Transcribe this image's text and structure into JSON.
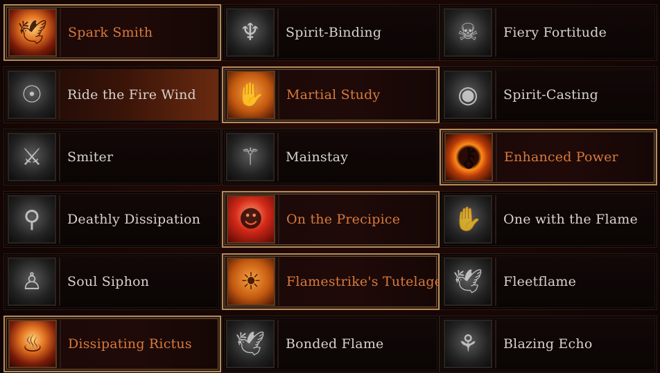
{
  "talents": [
    {
      "name": "Spark Smith",
      "active": true,
      "icon": "phoenix-icon",
      "glyph": "🕊",
      "style": "fire"
    },
    {
      "name": "Spirit-Binding",
      "active": false,
      "icon": "spirit-sigil-icon",
      "glyph": "♆",
      "style": "dark"
    },
    {
      "name": "Fiery Fortitude",
      "active": false,
      "icon": "horned-skull-icon",
      "glyph": "☠",
      "style": "dark"
    },
    {
      "name": "Ride the Fire Wind",
      "active": false,
      "icon": "robed-figure-icon",
      "glyph": "☉",
      "style": "dark"
    },
    {
      "name": "Martial Study",
      "active": true,
      "icon": "open-hand-icon",
      "glyph": "✋",
      "style": "orange"
    },
    {
      "name": "Spirit-Casting",
      "active": false,
      "icon": "rune-head-icon",
      "glyph": "◉",
      "style": "dark"
    },
    {
      "name": "Smiter",
      "active": false,
      "icon": "crouching-warrior-icon",
      "glyph": "⚔",
      "style": "dark"
    },
    {
      "name": "Mainstay",
      "active": false,
      "icon": "hooded-staff-icon",
      "glyph": "⚚",
      "style": "dark"
    },
    {
      "name": "Enhanced Power",
      "active": true,
      "icon": "keyhole-icon",
      "glyph": "⚷",
      "style": "keyhole"
    },
    {
      "name": "Deathly Dissipation",
      "active": false,
      "icon": "keyhole-figure-icon",
      "glyph": "⚲",
      "style": "dark"
    },
    {
      "name": "On the Precipice",
      "active": true,
      "icon": "face-burst-icon",
      "glyph": "☻",
      "style": "red"
    },
    {
      "name": "One with the Flame",
      "active": false,
      "icon": "spiral-hand-icon",
      "glyph": "✋",
      "style": "dark"
    },
    {
      "name": "Soul Siphon",
      "active": false,
      "icon": "raised-arms-icon",
      "glyph": "♙",
      "style": "dark"
    },
    {
      "name": "Flamestrike's Tutelage",
      "active": true,
      "icon": "halo-arms-icon",
      "glyph": "☀",
      "style": "orange"
    },
    {
      "name": "Fleetflame",
      "active": false,
      "icon": "dove-icon",
      "glyph": "🕊",
      "style": "dark"
    },
    {
      "name": "Dissipating Rictus",
      "active": true,
      "icon": "burning-figure-icon",
      "glyph": "♨",
      "style": "fire"
    },
    {
      "name": "Bonded Flame",
      "active": false,
      "icon": "dove-icon",
      "glyph": "🕊",
      "style": "dark"
    },
    {
      "name": "Blazing Echo",
      "active": false,
      "icon": "swirl-skull-icon",
      "glyph": "⚘",
      "style": "dark"
    }
  ]
}
